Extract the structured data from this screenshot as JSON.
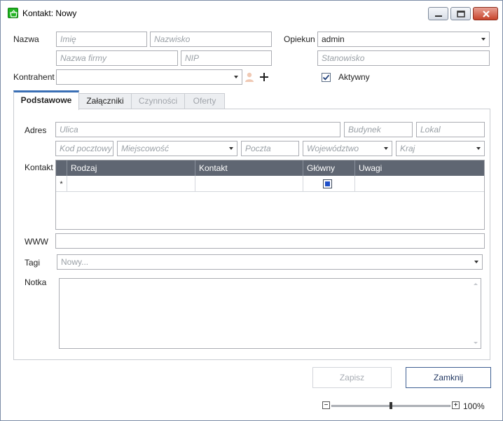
{
  "window": {
    "title": "Kontakt: Nowy"
  },
  "form": {
    "name_label": "Nazwa",
    "first_name_placeholder": "Imię",
    "last_name_placeholder": "Nazwisko",
    "company_placeholder": "Nazwa firmy",
    "nip_placeholder": "NIP",
    "contractor_label": "Kontrahent",
    "guardian_label": "Opiekun",
    "guardian_value": "admin",
    "position_placeholder": "Stanowisko",
    "active_label": "Aktywny",
    "active_checked": true
  },
  "tabs": [
    {
      "label": "Podstawowe",
      "active": true,
      "enabled": true
    },
    {
      "label": "Załączniki",
      "active": false,
      "enabled": true
    },
    {
      "label": "Czynności",
      "active": false,
      "enabled": false
    },
    {
      "label": "Oferty",
      "active": false,
      "enabled": false
    }
  ],
  "address": {
    "label": "Adres",
    "street_placeholder": "Ulica",
    "building_placeholder": "Budynek",
    "local_placeholder": "Lokal",
    "postal_placeholder": "Kod pocztowy",
    "city_placeholder": "Miejscowość",
    "post_placeholder": "Poczta",
    "voivodeship_placeholder": "Województwo",
    "country_placeholder": "Kraj"
  },
  "contact": {
    "label": "Kontakt",
    "columns": [
      "Rodzaj",
      "Kontakt",
      "Główny",
      "Uwagi"
    ],
    "new_row_marker": "*"
  },
  "www": {
    "label": "WWW"
  },
  "tags": {
    "label": "Tagi",
    "placeholder": "Nowy..."
  },
  "note": {
    "label": "Notka"
  },
  "buttons": {
    "save": "Zapisz",
    "close": "Zamknij"
  },
  "zoom": {
    "minus": "−",
    "plus": "+",
    "level": "100%",
    "value_percent": 100
  },
  "colors": {
    "accent": "#3a6fb5",
    "grid_header": "#5f6672",
    "check_fill": "#1e4fc8"
  }
}
